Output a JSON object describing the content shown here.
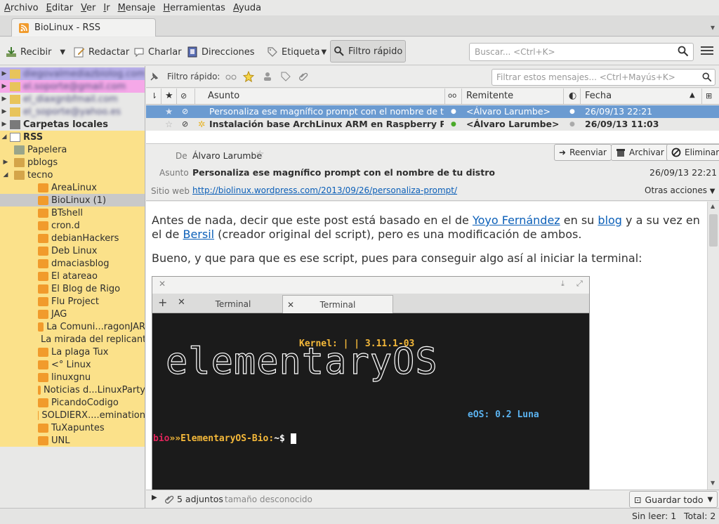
{
  "menubar": [
    "Archivo",
    "Editar",
    "Ver",
    "Ir",
    "Mensaje",
    "Herramientas",
    "Ayuda"
  ],
  "tab": {
    "title": "BioLinux - RSS"
  },
  "toolbar": {
    "receive": "Recibir",
    "compose": "Redactar",
    "chat": "Charlar",
    "addressbook": "Direcciones",
    "tag": "Etiqueta",
    "quickfilter": "Filtro rápido",
    "search_placeholder": "Buscar... <Ctrl+K>"
  },
  "folders": {
    "accounts": [
      "diegovalmediazbiolog.com",
      "el.soporte@gmail.com",
      "el_diaxgnbfmail.com",
      "el_soporte@yahoo.es"
    ],
    "local": "Carpetas locales",
    "rss": "RSS",
    "papelera": "Papelera",
    "pblogs": "pblogs",
    "tecno": "tecno",
    "feeds": [
      "AreaLinux",
      "BioLinux (1)",
      "BTshell",
      "cron.d",
      "debianHackers",
      "Deb Linux",
      "dmaciasblog",
      "El atareao",
      "El Blog de Rigo",
      "Flu Project",
      "JAG",
      "La Comuni...ragonJAR",
      "La mirada del replicante",
      "La plaga Tux",
      "<° Linux",
      "linuxgnu",
      "Noticias d...LinuxParty",
      "PicandoCodigo",
      "SOLDIERX....emination",
      "TuXapuntes",
      "UNL"
    ]
  },
  "quickfilter": {
    "label": "Filtro rápido:",
    "placeholder": "Filtrar estos mensajes... <Ctrl+Mayús+K>"
  },
  "thread": {
    "columns": {
      "subject": "Asunto",
      "sender": "Remitente",
      "date": "Fecha"
    },
    "rows": [
      {
        "subject": "Personaliza ese magnífico prompt con el nombre de tu dis...",
        "sender": "<Álvaro Larumbe>",
        "date": "26/09/13 22:21"
      },
      {
        "subject": "Instalación base ArchLinux ARM en Raspberry Pi",
        "sender": "<Álvaro Larumbe>",
        "date": "26/09/13 11:03"
      }
    ]
  },
  "message": {
    "from_label": "De",
    "from": "Álvaro Larumbe",
    "subject_label": "Asunto",
    "subject": "Personaliza ese magnífico prompt con el nombre de tu distro",
    "date": "26/09/13 22:21",
    "website_label": "Sitio web",
    "website": "http://biolinux.wordpress.com/2013/09/26/personaliza-prompt/",
    "other_actions": "Otras acciones",
    "reply": "Reenviar",
    "archive": "Archivar",
    "delete": "Eliminar"
  },
  "body": {
    "p1_a": "Antes de nada, decir que este post está basado en el de ",
    "p1_link1": "Yoyo Fernández",
    "p1_b": " en su ",
    "p1_link2": "blog",
    "p1_c": " y a su vez en el de ",
    "p1_link3": "Bersil",
    "p1_d": " (creador original del script), pero es una modificación de ambos.",
    "p2": "Bueno, y que para que es ese script, pues para conseguir algo así al iniciar la terminal:"
  },
  "terminal": {
    "tab1": "Terminal",
    "tab2": "Terminal",
    "kernel": "Kernel: | | 3.11.1-03",
    "eos": "eOS: 0.2 Luna",
    "prompt_user": "bio",
    "prompt_sep": "»»",
    "prompt_host": "ElementaryOS-Bio:",
    "prompt_path": "~$"
  },
  "attachments": {
    "count": "5 adjuntos",
    "size": "tamaño desconocido",
    "save_all": "Guardar todo"
  },
  "status": {
    "unread": "Sin leer: 1",
    "total": "Total: 2"
  }
}
